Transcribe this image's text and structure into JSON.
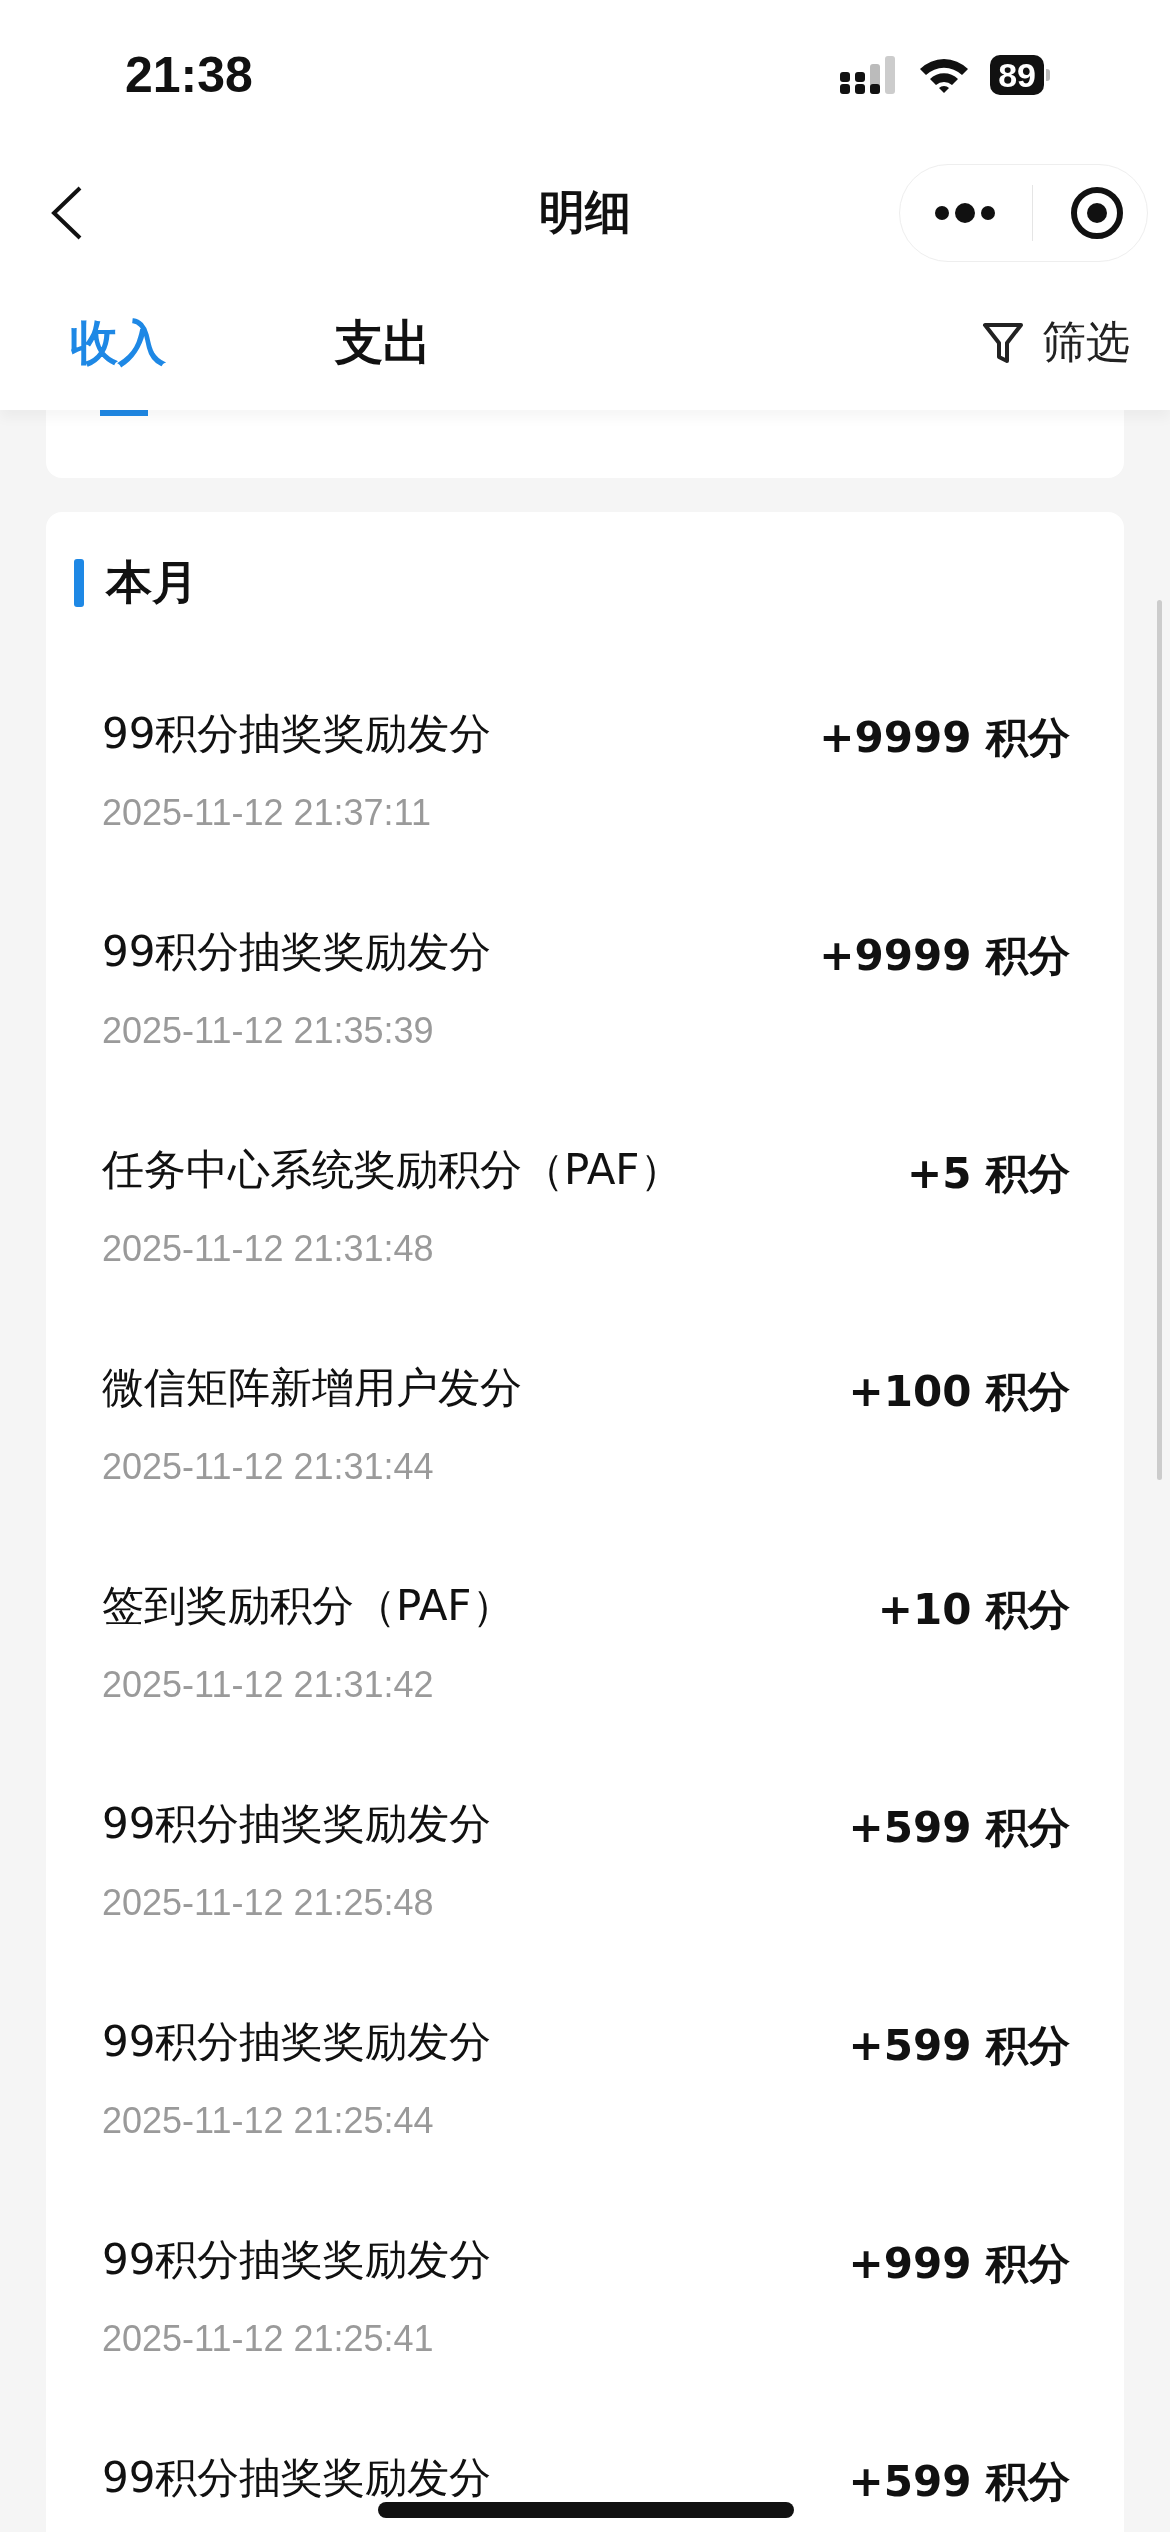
{
  "status_bar": {
    "time": "21:38",
    "battery": "89"
  },
  "nav": {
    "title": "明细"
  },
  "tabs": [
    {
      "label": "收入",
      "selected": true
    },
    {
      "label": "支出",
      "selected": false
    }
  ],
  "filter": {
    "label": "筛选"
  },
  "section": {
    "title": "本月",
    "rows": [
      {
        "title": "99积分抽奖奖励发分",
        "time": "2025-11-12 21:37:11",
        "amount": "+9999 积分"
      },
      {
        "title": "99积分抽奖奖励发分",
        "time": "2025-11-12 21:35:39",
        "amount": "+9999 积分"
      },
      {
        "title": "任务中心系统奖励积分（PAF）",
        "time": "2025-11-12 21:31:48",
        "amount": "+5 积分"
      },
      {
        "title": "微信矩阵新增用户发分",
        "time": "2025-11-12 21:31:44",
        "amount": "+100 积分"
      },
      {
        "title": "签到奖励积分（PAF）",
        "time": "2025-11-12 21:31:42",
        "amount": "+10 积分"
      },
      {
        "title": "99积分抽奖奖励发分",
        "time": "2025-11-12 21:25:48",
        "amount": "+599 积分"
      },
      {
        "title": "99积分抽奖奖励发分",
        "time": "2025-11-12 21:25:44",
        "amount": "+599 积分"
      },
      {
        "title": "99积分抽奖奖励发分",
        "time": "2025-11-12 21:25:41",
        "amount": "+999 积分"
      },
      {
        "title": "99积分抽奖奖励发分",
        "amount": "+599 积分"
      }
    ]
  }
}
